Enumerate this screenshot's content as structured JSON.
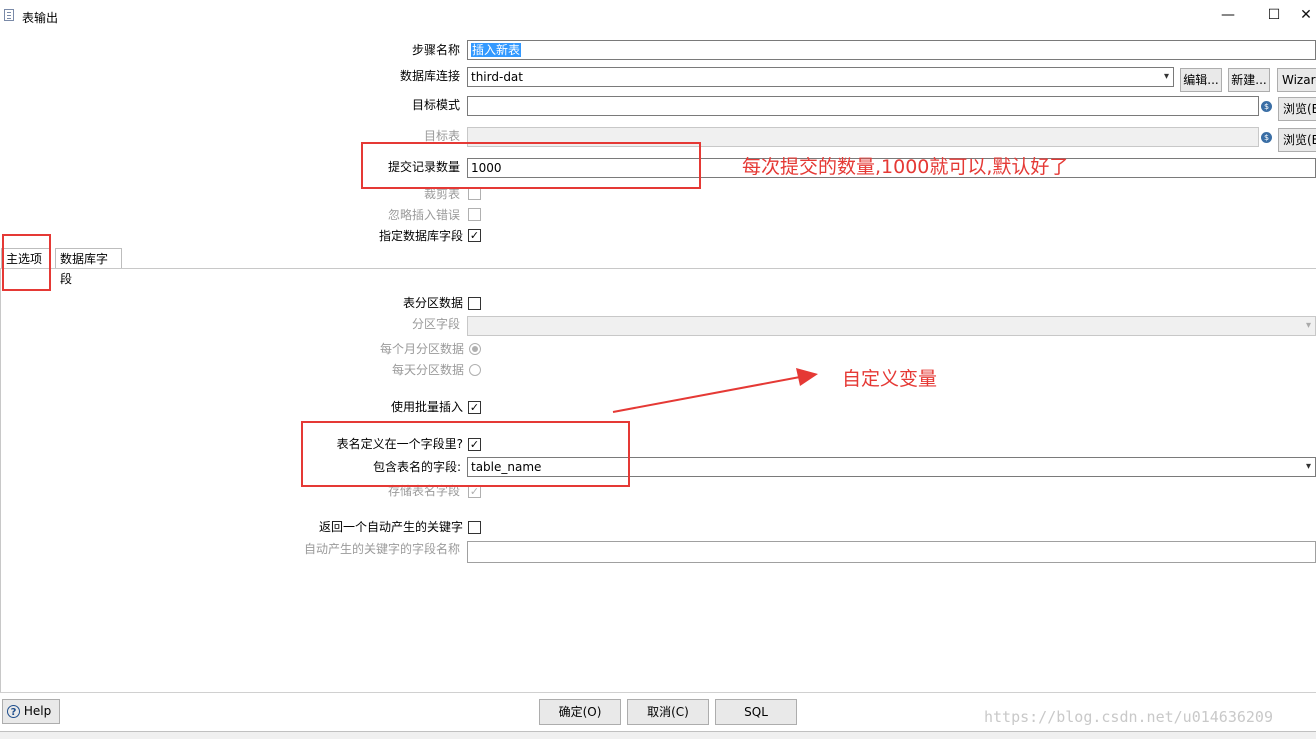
{
  "window": {
    "title": "表输出",
    "minimize_glyph": "—",
    "maximize_glyph": "☐",
    "close_glyph": "✕"
  },
  "form": {
    "step_name_label": "步骤名称",
    "step_name_value": "插入新表",
    "db_connection_label": "数据库连接",
    "db_connection_value": "third-dat",
    "edit_button": "编辑...",
    "new_button": "新建...",
    "wizard_button": "Wizard",
    "target_schema_label": "目标模式",
    "target_schema_value": "",
    "browse_button": "浏览(B)...",
    "target_table_label": "目标表",
    "target_table_value": "",
    "commit_size_label": "提交记录数量",
    "commit_size_value": "1000",
    "truncate_label": "裁剪表",
    "ignore_errors_label": "忽略插入错误",
    "specify_fields_label": "指定数据库字段"
  },
  "tabs": [
    {
      "label": "主选项"
    },
    {
      "label": "数据库字段"
    }
  ],
  "main_options": {
    "partition_label": "表分区数据",
    "partition_field_label": "分区字段",
    "partition_field_value": "",
    "monthly_label": "每个月分区数据",
    "daily_label": "每天分区数据",
    "batch_insert_label": "使用批量插入",
    "table_in_field_label": "表名定义在一个字段里?",
    "table_name_field_label": "包含表名的字段:",
    "table_name_field_value": "table_name",
    "store_table_name_label": "存储表名字段",
    "return_key_label": "返回一个自动产生的关键字",
    "key_field_name_label": "自动产生的关键字的字段名称",
    "key_field_name_value": ""
  },
  "annotations": {
    "commit_note": "每次提交的数量,1000就可以,默认好了",
    "variable_note": "自定义变量"
  },
  "footer": {
    "help_label": "Help",
    "ok_label": "确定(O)",
    "cancel_label": "取消(C)",
    "sql_label": "SQL",
    "watermark": "https://blog.csdn.net/u014636209"
  },
  "colors": {
    "annotation_red": "#e53935",
    "selection_blue": "#3399ff"
  }
}
